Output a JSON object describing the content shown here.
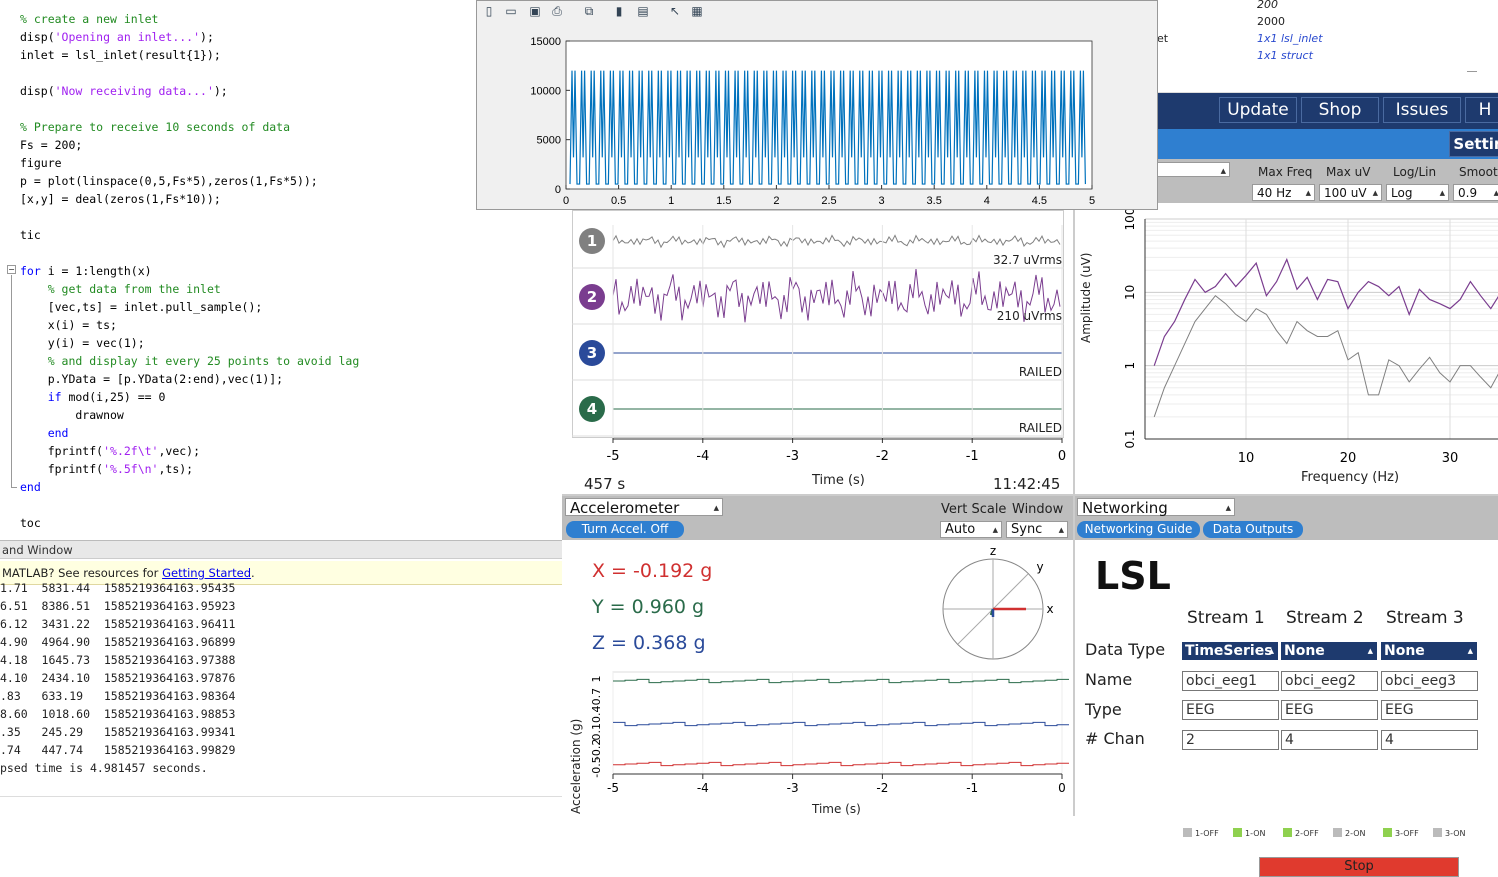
{
  "editor": {
    "lines": [
      {
        "parts": [
          {
            "t": "% create a new inlet",
            "c": "comment"
          }
        ]
      },
      {
        "parts": [
          {
            "t": "disp(",
            "c": ""
          },
          {
            "t": "'Opening an inlet...'",
            "c": "string"
          },
          {
            "t": ");",
            "c": ""
          }
        ]
      },
      {
        "parts": [
          {
            "t": "inlet = lsl_inlet(result{1});",
            "c": ""
          }
        ]
      },
      {
        "parts": []
      },
      {
        "parts": [
          {
            "t": "disp(",
            "c": ""
          },
          {
            "t": "'Now receiving data...'",
            "c": "string"
          },
          {
            "t": ");",
            "c": ""
          }
        ]
      },
      {
        "parts": []
      },
      {
        "parts": [
          {
            "t": "% Prepare to receive 10 seconds of data",
            "c": "comment"
          }
        ]
      },
      {
        "parts": [
          {
            "t": "Fs = 200;",
            "c": ""
          }
        ]
      },
      {
        "parts": [
          {
            "t": "figure",
            "c": ""
          }
        ]
      },
      {
        "parts": [
          {
            "t": "p = plot(linspace(0,5,Fs*5),zeros(1,Fs*5));",
            "c": ""
          }
        ]
      },
      {
        "parts": [
          {
            "t": "[x,y] = deal(zeros(1,Fs*10));",
            "c": ""
          }
        ]
      },
      {
        "parts": []
      },
      {
        "parts": [
          {
            "t": "tic",
            "c": ""
          }
        ]
      },
      {
        "parts": []
      },
      {
        "parts": [
          {
            "t": "for",
            "c": "kw"
          },
          {
            "t": " i = 1:length(x)",
            "c": ""
          }
        ]
      },
      {
        "parts": [
          {
            "t": "    ",
            "c": ""
          },
          {
            "t": "% get data from the inlet",
            "c": "comment"
          }
        ]
      },
      {
        "parts": [
          {
            "t": "    [vec,ts] = inlet.pull_sample();",
            "c": ""
          }
        ]
      },
      {
        "parts": [
          {
            "t": "    x(i) = ts;",
            "c": ""
          }
        ]
      },
      {
        "parts": [
          {
            "t": "    y(i) = vec(1);",
            "c": ""
          }
        ]
      },
      {
        "parts": [
          {
            "t": "    ",
            "c": ""
          },
          {
            "t": "% and display it every 25 points to avoid lag",
            "c": "comment"
          }
        ]
      },
      {
        "parts": [
          {
            "t": "    p.YData = [p.YData(2:end),vec(1)];",
            "c": ""
          }
        ]
      },
      {
        "parts": [
          {
            "t": "    ",
            "c": ""
          },
          {
            "t": "if",
            "c": "kw"
          },
          {
            "t": " mod(i,25) == 0",
            "c": ""
          }
        ]
      },
      {
        "parts": [
          {
            "t": "        drawnow",
            "c": ""
          }
        ]
      },
      {
        "parts": [
          {
            "t": "    ",
            "c": ""
          },
          {
            "t": "end",
            "c": "kw"
          }
        ]
      },
      {
        "parts": [
          {
            "t": "    fprintf(",
            "c": ""
          },
          {
            "t": "'%.2f\\t'",
            "c": "string"
          },
          {
            "t": ",vec);",
            "c": ""
          }
        ]
      },
      {
        "parts": [
          {
            "t": "    fprintf(",
            "c": ""
          },
          {
            "t": "'%.5f\\n'",
            "c": "string"
          },
          {
            "t": ",ts);",
            "c": ""
          }
        ]
      },
      {
        "parts": [
          {
            "t": "end",
            "c": "kw"
          }
        ]
      },
      {
        "parts": []
      },
      {
        "parts": [
          {
            "t": "toc",
            "c": ""
          }
        ]
      }
    ]
  },
  "command_window": {
    "title": "and Window",
    "banner_text": "MATLAB? See resources for ",
    "banner_link": "Getting Started",
    "banner_end": ".",
    "output_lines": [
      "1.71  5831.44  1585219364163.95435",
      "6.51  8386.51  1585219364163.95923",
      "6.12  3431.22  1585219364163.96411",
      "4.90  4964.90  1585219364163.96899",
      "4.18  1645.73  1585219364163.97388",
      "4.10  2434.10  1585219364163.97876",
      ".83   633.19   1585219364163.98364",
      "8.60  1018.60  1585219364163.98853",
      ".35   245.29   1585219364163.99341",
      ".74   447.74   1585219364163.99829",
      "psed time is 4.981457 seconds."
    ]
  },
  "workspace": {
    "values": [
      "200",
      "2000",
      "1x1 lsl_inlet",
      "1x1 struct"
    ],
    "partial_name": "et"
  },
  "figure": {
    "toolbar_icons": [
      "new-icon",
      "open-icon",
      "save-icon",
      "print-icon",
      "link-icon",
      "colorbar-icon",
      "legend-icon",
      "pointer-icon",
      "property-icon"
    ],
    "y_ticks": [
      "15000",
      "10000",
      "5000",
      "0"
    ],
    "x_ticks": [
      "0",
      "0.5",
      "1",
      "1.5",
      "2",
      "2.5",
      "3",
      "3.5",
      "4",
      "4.5",
      "5"
    ],
    "line_color": "#0072bd"
  },
  "gui": {
    "nav": [
      "Update",
      "Shop",
      "Issues",
      "H"
    ],
    "settings_label": "Settin",
    "fft_headers": [
      "Max Freq",
      "Max uV",
      "Log/Lin",
      "Smoot"
    ],
    "fft_values": [
      "40 Hz",
      "100 uV",
      "Log",
      "0.9"
    ],
    "channels": [
      {
        "num": "1",
        "color": "#808080",
        "label": "32.7 uVrms"
      },
      {
        "num": "2",
        "color": "#7a3d8f",
        "label": "210 uVrms"
      },
      {
        "num": "3",
        "color": "#2a4a9a",
        "label": "RAILED"
      },
      {
        "num": "4",
        "color": "#2a6b4a",
        "label": "RAILED"
      }
    ],
    "ts_x_ticks": [
      "-5",
      "-4",
      "-3",
      "-2",
      "-1",
      "0"
    ],
    "ts_xlabel": "Time (s)",
    "ts_elapsed": "457 s",
    "ts_clock": "11:42:45",
    "fft_ylabel": "Amplitude (uV)",
    "fft_y_ticks": [
      "100",
      "10",
      "1",
      "0.1"
    ],
    "fft_x_ticks": [
      "10",
      "20",
      "30"
    ],
    "fft_xlabel": "Frequency (Hz)",
    "accel": {
      "title": "Accelerometer",
      "vert_scale_label": "Vert Scale",
      "window_label": "Window",
      "vert_scale_value": "Auto",
      "window_value": "Sync",
      "toggle_button": "Turn Accel. Off",
      "x_text": "X = -0.192 g",
      "y_text": "Y = 0.960 g",
      "z_text": "Z = 0.368 g",
      "x_color": "#d03030",
      "y_color": "#2a6b4a",
      "z_color": "#2a4a9a",
      "compass_labels": [
        "z",
        "y",
        "x"
      ],
      "ylabel": "Acceleration (g)",
      "y_ticks": [
        "1",
        "0.7",
        "0.4",
        "0.1",
        "-0.2",
        "-0.5"
      ],
      "x_ticks": [
        "-5",
        "-4",
        "-3",
        "-2",
        "-1",
        "0"
      ],
      "xlabel": "Time (s)"
    },
    "networking": {
      "title": "Networking",
      "guide_button": "Networking Guide",
      "outputs_button": "Data Outputs",
      "protocol": "LSL",
      "streams": [
        "Stream 1",
        "Stream 2",
        "Stream 3"
      ],
      "row_labels": [
        "Data Type",
        "Name",
        "Type",
        "# Chan"
      ],
      "data_types": [
        "TimeSeries",
        "None",
        "None"
      ],
      "names": [
        "obci_eeg1",
        "obci_eeg2",
        "obci_eeg3"
      ],
      "types": [
        "EEG",
        "EEG",
        "EEG"
      ],
      "chans": [
        "2",
        "4",
        "4"
      ],
      "legend": [
        {
          "label": "1-OFF",
          "color": "#bbbbbb"
        },
        {
          "label": "1-ON",
          "color": "#8fd14f"
        },
        {
          "label": "2-OFF",
          "color": "#8fd14f"
        },
        {
          "label": "2-ON",
          "color": "#bbbbbb"
        },
        {
          "label": "3-OFF",
          "color": "#8fd14f"
        },
        {
          "label": "3-ON",
          "color": "#bbbbbb"
        }
      ],
      "stop_button": "Stop",
      "stop_color": "#e03a2e"
    }
  }
}
